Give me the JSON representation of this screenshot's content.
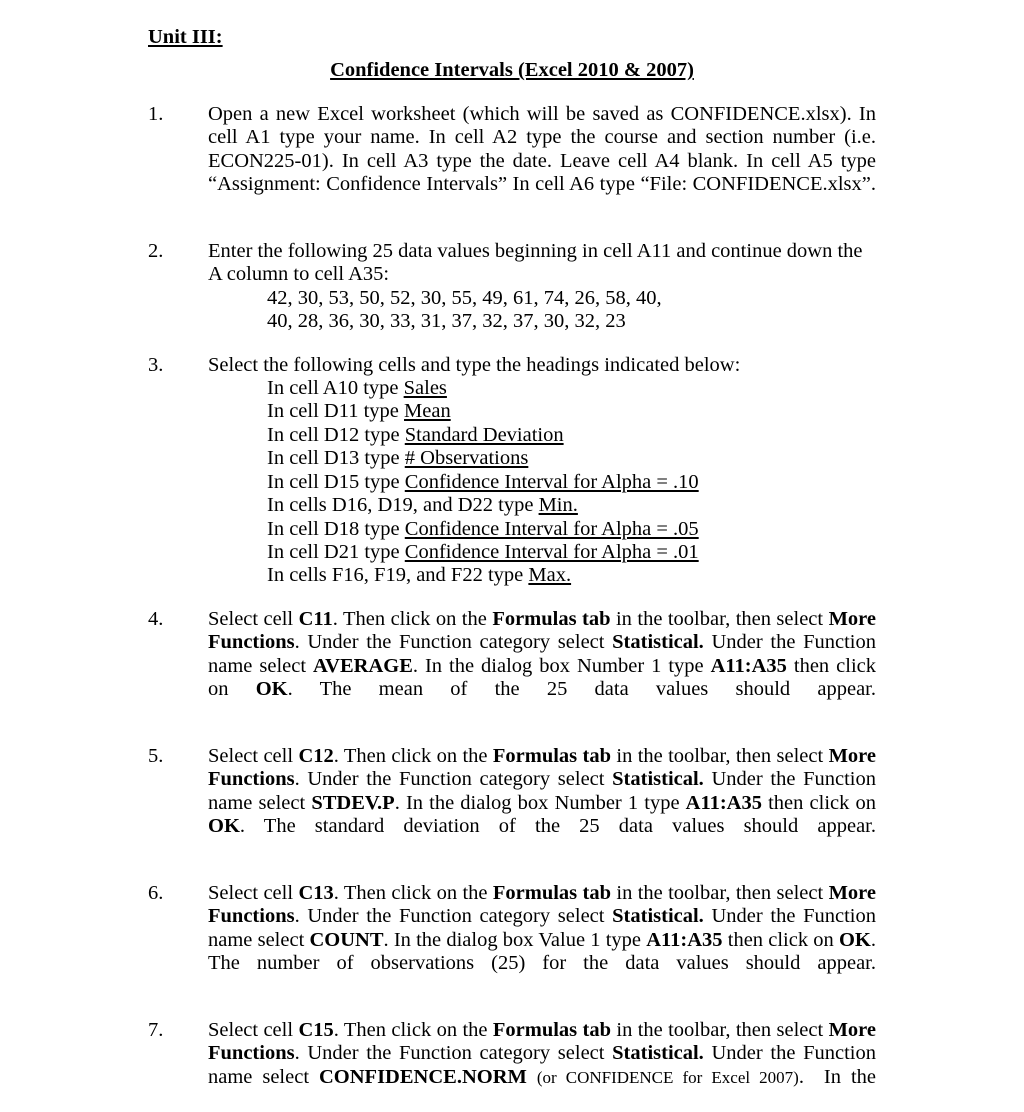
{
  "document": {
    "unit_heading": "Unit III:",
    "title": "Confidence Intervals (Excel 2010 & 2007)",
    "items": [
      {
        "number": "1.",
        "text": "Open a new Excel worksheet (which will be saved as CONFIDENCE.xlsx).  In cell A1 type your name.  In cell A2 type the course and section number (i.e. ECON225-01).  In cell A3 type the date.  Leave cell A4 blank.  In cell A5 type “Assignment:  Confidence Intervals”  In cell A6 type “File: CONFIDENCE.xlsx”."
      },
      {
        "number": "2.",
        "text": "Enter the following 25 data values beginning in cell A11 and continue down the A column to cell A35:",
        "data_rows": [
          "42, 30, 53, 50, 52, 30, 55, 49, 61, 74, 26, 58, 40,",
          "40, 28, 36, 30, 33, 31, 37, 32, 37, 30, 32, 23"
        ],
        "data_values": [
          42,
          30,
          53,
          50,
          52,
          30,
          55,
          49,
          61,
          74,
          26,
          58,
          40,
          40,
          28,
          36,
          30,
          33,
          31,
          37,
          32,
          37,
          30,
          32,
          23
        ]
      },
      {
        "number": "3.",
        "text": "Select the following cells and type the headings indicated below:",
        "headings": [
          {
            "lead": "In cell A10 type ",
            "underlined": "Sales"
          },
          {
            "lead": "In cell D11 type ",
            "underlined": "Mean"
          },
          {
            "lead": "In cell D12 type ",
            "underlined": "Standard Deviation"
          },
          {
            "lead": "In cell D13 type ",
            "underlined": "# Observations"
          },
          {
            "lead": "In cell D15 type ",
            "underlined": "Confidence Interval for Alpha = .10"
          },
          {
            "lead": "In cells D16, D19, and D22 type ",
            "underlined": "Min."
          },
          {
            "lead": "In cell D18 type ",
            "underlined": "Confidence Interval for Alpha = .05"
          },
          {
            "lead": "In cell D21 type ",
            "underlined": "Confidence Interval for Alpha = .01"
          },
          {
            "lead": "In cells F16, F19, and F22 type ",
            "underlined": "Max."
          }
        ]
      },
      {
        "number": "4.",
        "cell": "C11",
        "function_name": "AVERAGE",
        "dialog_field": "Number 1",
        "range": "A11:A35",
        "result_text": "The mean of the 25 data values should appear."
      },
      {
        "number": "5.",
        "cell": "C12",
        "function_name": "STDEV.P",
        "dialog_field": "Number 1",
        "range": "A11:A35",
        "result_text": "The standard deviation of the 25 data values should appear."
      },
      {
        "number": "6.",
        "cell": "C13",
        "function_name": "COUNT",
        "dialog_field": "Value 1",
        "range": "A11:A35",
        "result_text": "The number of observations (25) for the data values should appear."
      },
      {
        "number": "7.",
        "cell": "C15",
        "function_name": "CONFIDENCE.NORM",
        "alt_function_note": "(or CONFIDENCE for Excel 2007)",
        "trailing": "In the"
      }
    ],
    "phrases": {
      "select_cell": "Select cell ",
      "then_click": ". Then click on the ",
      "formulas_tab": "Formulas tab",
      "in_toolbar": " in the toolbar, then select ",
      "more_functions_more": "More",
      "more_functions_functions": "Functions",
      "under_category": ". Under the Function category select ",
      "statistical": "Statistical.",
      "under_name": "  Under the Function name select ",
      "in_dialog_box": ".  In the dialog box ",
      "type_word": " type ",
      "then_click_on": " then click on ",
      "ok": "OK",
      "period_two_spaces": ".  ",
      "space": " "
    }
  }
}
